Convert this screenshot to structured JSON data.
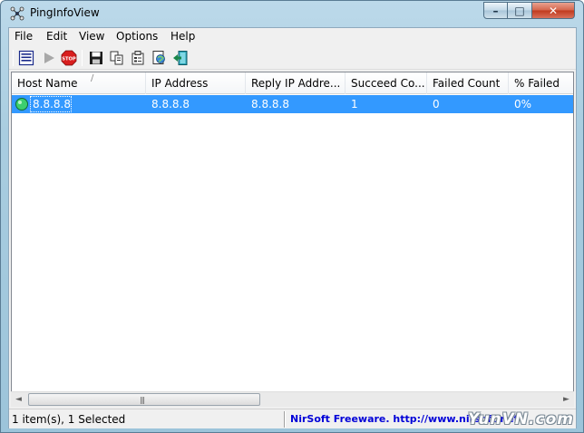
{
  "window": {
    "title": "PingInfoView",
    "controls": {
      "minimize": "–",
      "maximize": "□",
      "close": "✕"
    }
  },
  "menu": {
    "items": [
      "File",
      "Edit",
      "View",
      "Options",
      "Help"
    ]
  },
  "toolbar": {
    "buttons": [
      "options-icon",
      "start-icon",
      "stop-icon",
      "save-icon",
      "copy-icon",
      "properties-icon",
      "html-report-icon",
      "exit-icon"
    ]
  },
  "list": {
    "columns": [
      "Host Name",
      "IP Address",
      "Reply IP Addre...",
      "Succeed Co...",
      "Failed Count",
      "% Failed"
    ],
    "sort_indicator": "/",
    "rows": [
      {
        "host_name": "8.8.8.8",
        "ip_address": "8.8.8.8",
        "reply_ip": "8.8.8.8",
        "succeed_count": "1",
        "failed_count": "0",
        "percent_failed": "0%",
        "selected": true
      }
    ]
  },
  "scrollbar": {
    "left_arrow": "◄",
    "right_arrow": "►",
    "grip": "|||"
  },
  "status": {
    "items_text": "1 item(s), 1 Selected",
    "link_text": "NirSoft Freeware.  http://www.nirsoft.net"
  },
  "watermark": "YunVN.com",
  "colors": {
    "selection": "#3399ff",
    "link": "#0000d8",
    "close_button": "#c0391d"
  }
}
